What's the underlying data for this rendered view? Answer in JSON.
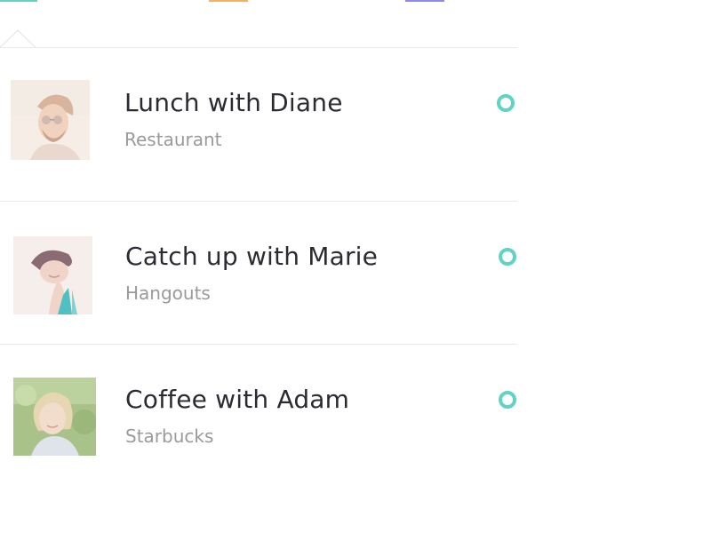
{
  "colors": {
    "accent_teal": "#5fd3c4",
    "tab_orange": "#f5b25a",
    "tab_purple": "#8f87f2",
    "title_text": "#2b2b33",
    "subtitle_text": "#9a9a9a",
    "divider": "#e9e9e9"
  },
  "tabs": [
    {
      "indicator_color": "#5fd3c4",
      "selected": true
    },
    {
      "indicator_color": "#f5b25a",
      "selected": false
    },
    {
      "indicator_color": "#8f87f2",
      "selected": false
    }
  ],
  "events": [
    {
      "title": "Lunch with Diane",
      "subtitle": "Restaurant",
      "avatar_icon": "avatar-man-with-sunglasses",
      "status_icon": "status-ring-icon"
    },
    {
      "title": "Catch up with Marie",
      "subtitle": "Hangouts",
      "avatar_icon": "avatar-woman-laughing",
      "status_icon": "status-ring-icon"
    },
    {
      "title": "Coffee with Adam",
      "subtitle": "Starbucks",
      "avatar_icon": "avatar-blonde-person",
      "status_icon": "status-ring-icon"
    }
  ]
}
